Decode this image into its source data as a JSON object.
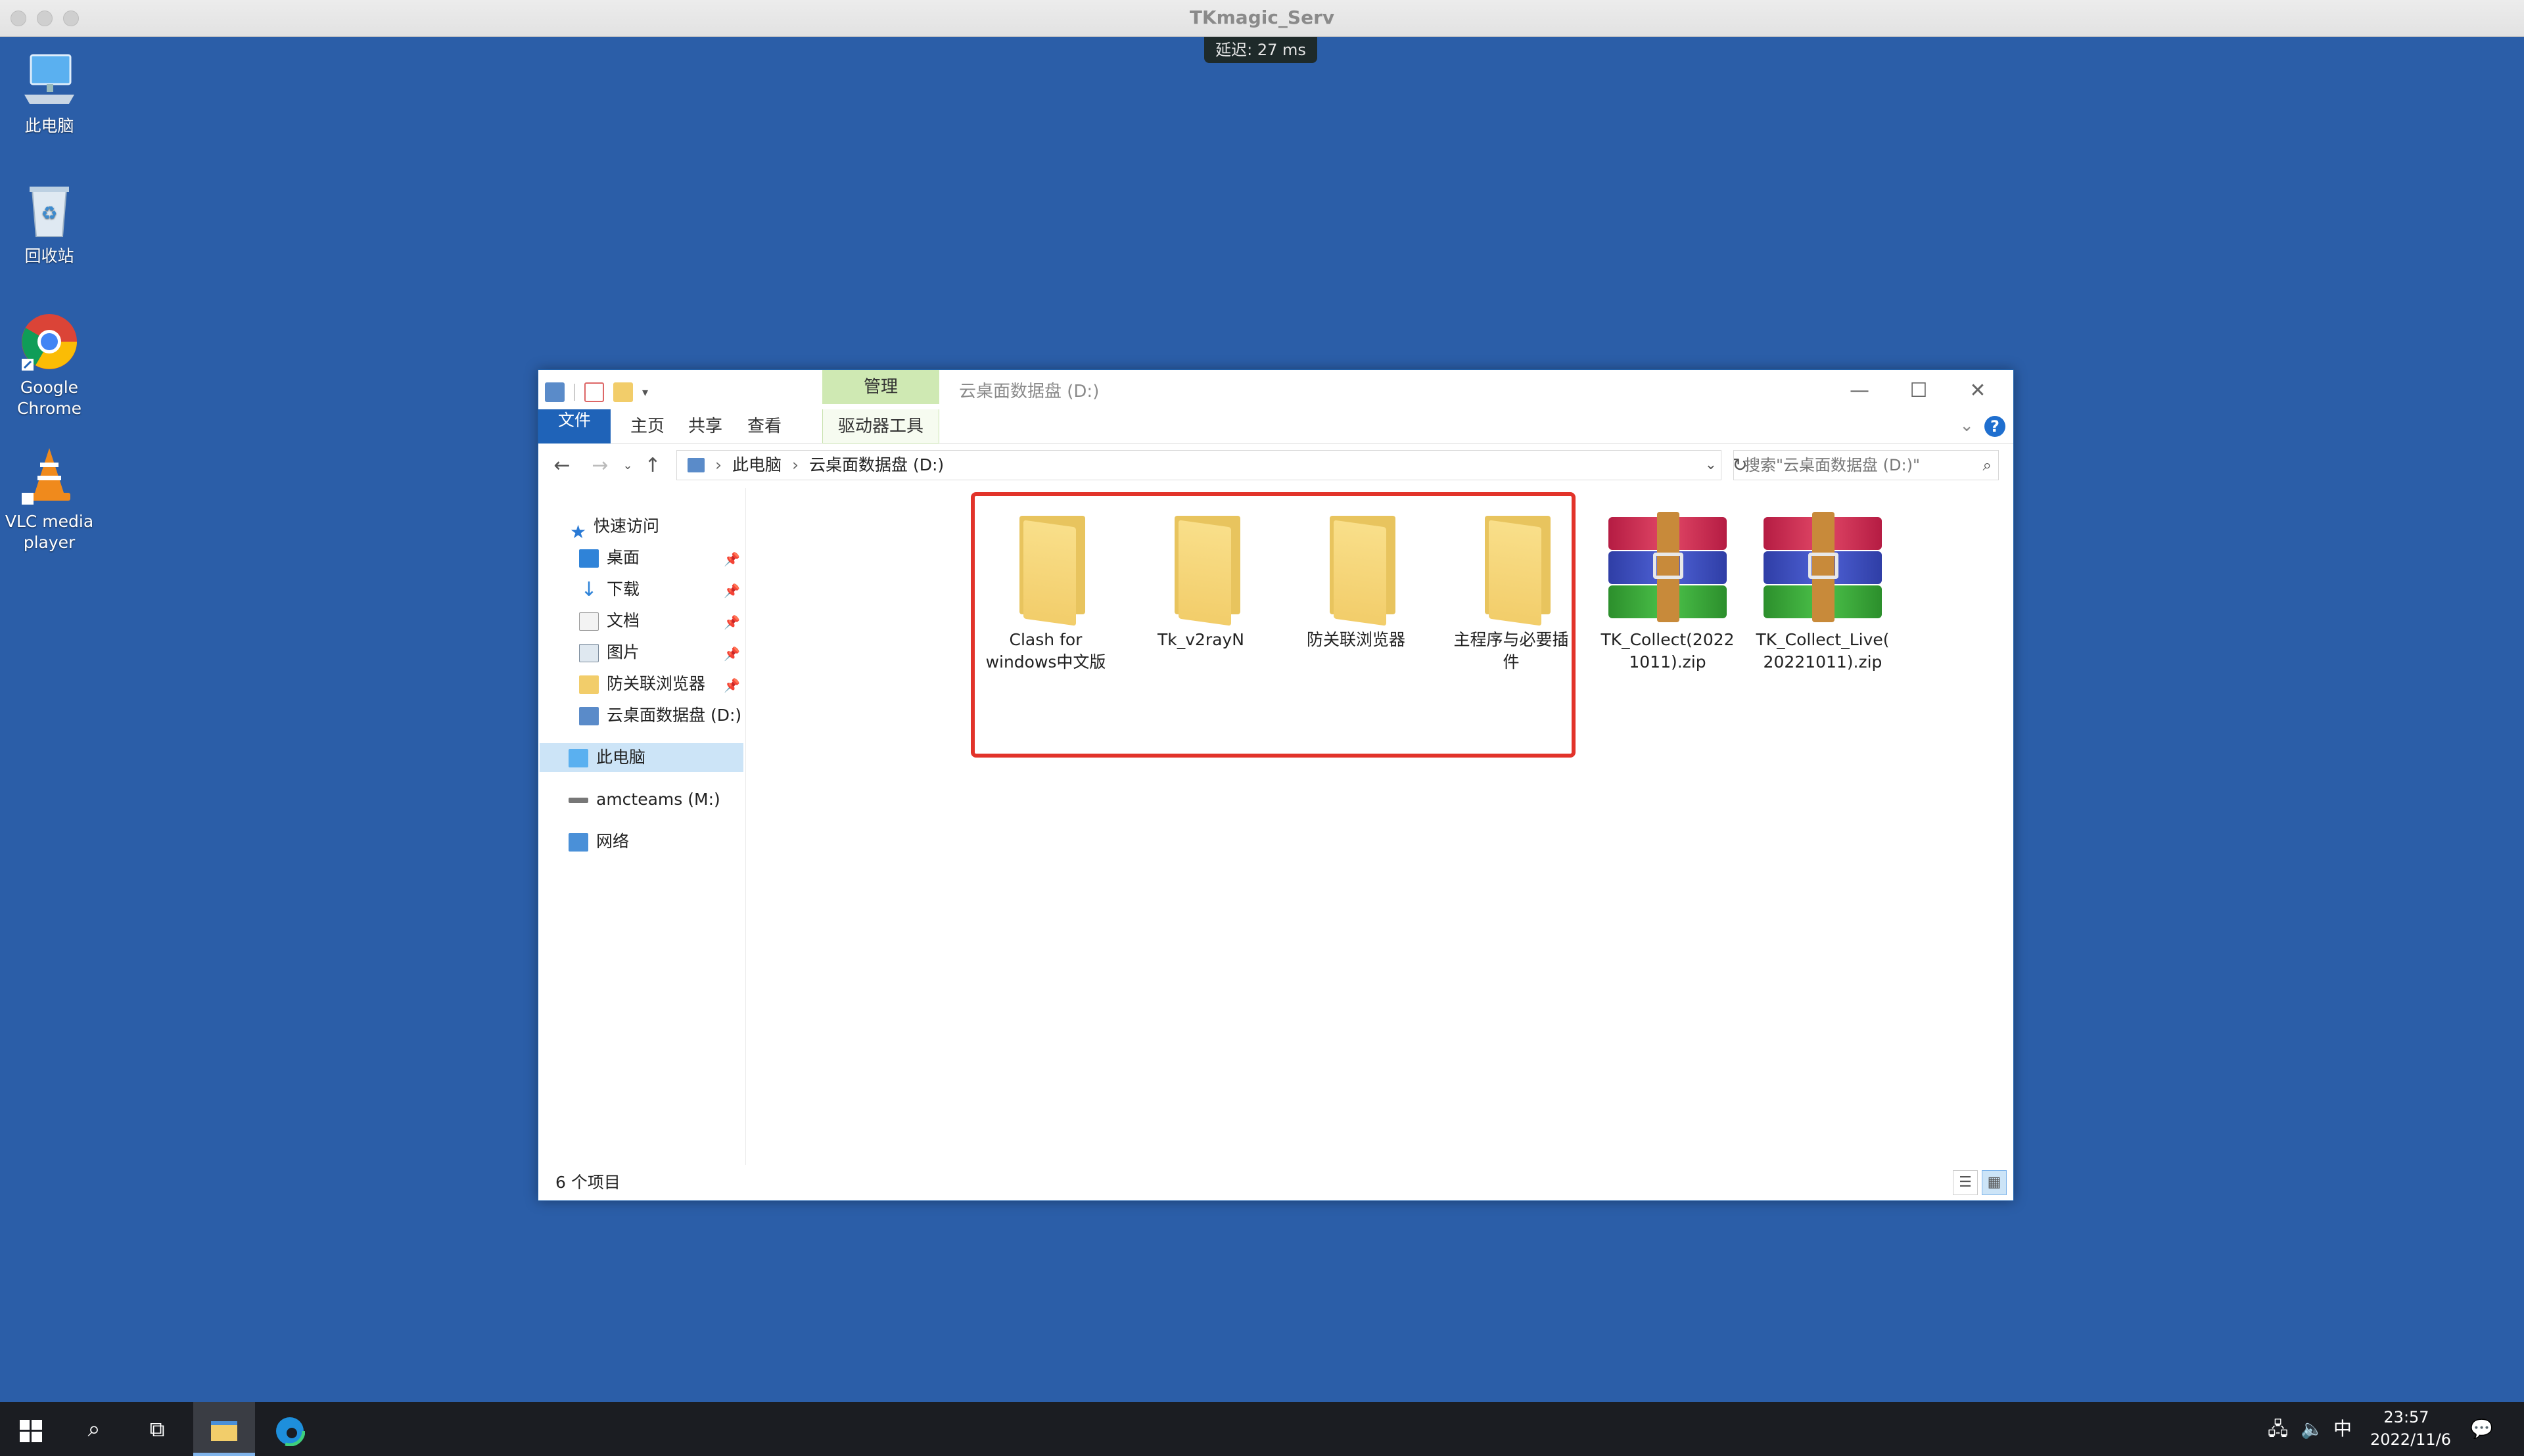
{
  "window_title": "TKmagic_Serv",
  "latency": "延迟: 27 ms",
  "desktop": {
    "icons": [
      {
        "label": "此电脑"
      },
      {
        "label": "回收站"
      },
      {
        "label": "Google Chrome"
      },
      {
        "label": "VLC media player"
      }
    ]
  },
  "explorer": {
    "title": "云桌面数据盘 (D:)",
    "contextual_tab_group": "管理",
    "ribbon_tabs": [
      "文件",
      "主页",
      "共享",
      "查看",
      "驱动器工具"
    ],
    "breadcrumb": [
      "此电脑",
      "云桌面数据盘 (D:)"
    ],
    "search_placeholder": "搜索\"云桌面数据盘 (D:)\"",
    "nav": {
      "quick_access": "快速访问",
      "items": [
        {
          "label": "桌面",
          "pinned": true
        },
        {
          "label": "下载",
          "pinned": true
        },
        {
          "label": "文档",
          "pinned": true
        },
        {
          "label": "图片",
          "pinned": true
        },
        {
          "label": "防关联浏览器",
          "pinned": true
        },
        {
          "label": "云桌面数据盘 (D:)",
          "pinned": false
        }
      ],
      "this_pc": "此电脑",
      "network_drive": "amcteams (M:)",
      "network": "网络"
    },
    "files": [
      {
        "name_line1": "Clash for",
        "name_line2": "windows中文版",
        "type": "folder"
      },
      {
        "name_line1": "Tk_v2rayN",
        "name_line2": "",
        "type": "folder"
      },
      {
        "name_line1": "防关联浏览器",
        "name_line2": "",
        "type": "folder"
      },
      {
        "name_line1": "主程序与必要插",
        "name_line2": "件",
        "type": "folder"
      },
      {
        "name_line1": "TK_Collect(2022",
        "name_line2": "1011).zip",
        "type": "rar"
      },
      {
        "name_line1": "TK_Collect_Live(",
        "name_line2": "20221011).zip",
        "type": "rar"
      }
    ],
    "status": "6 个项目"
  },
  "taskbar": {
    "tray_lang": "中",
    "time": "23:57",
    "date": "2022/11/6"
  },
  "colors": {
    "desktop_bg": "#2b5ea8",
    "highlight": "#e2332a",
    "file_tab": "#1f63b8",
    "manage_tab": "#cfe9b3"
  }
}
